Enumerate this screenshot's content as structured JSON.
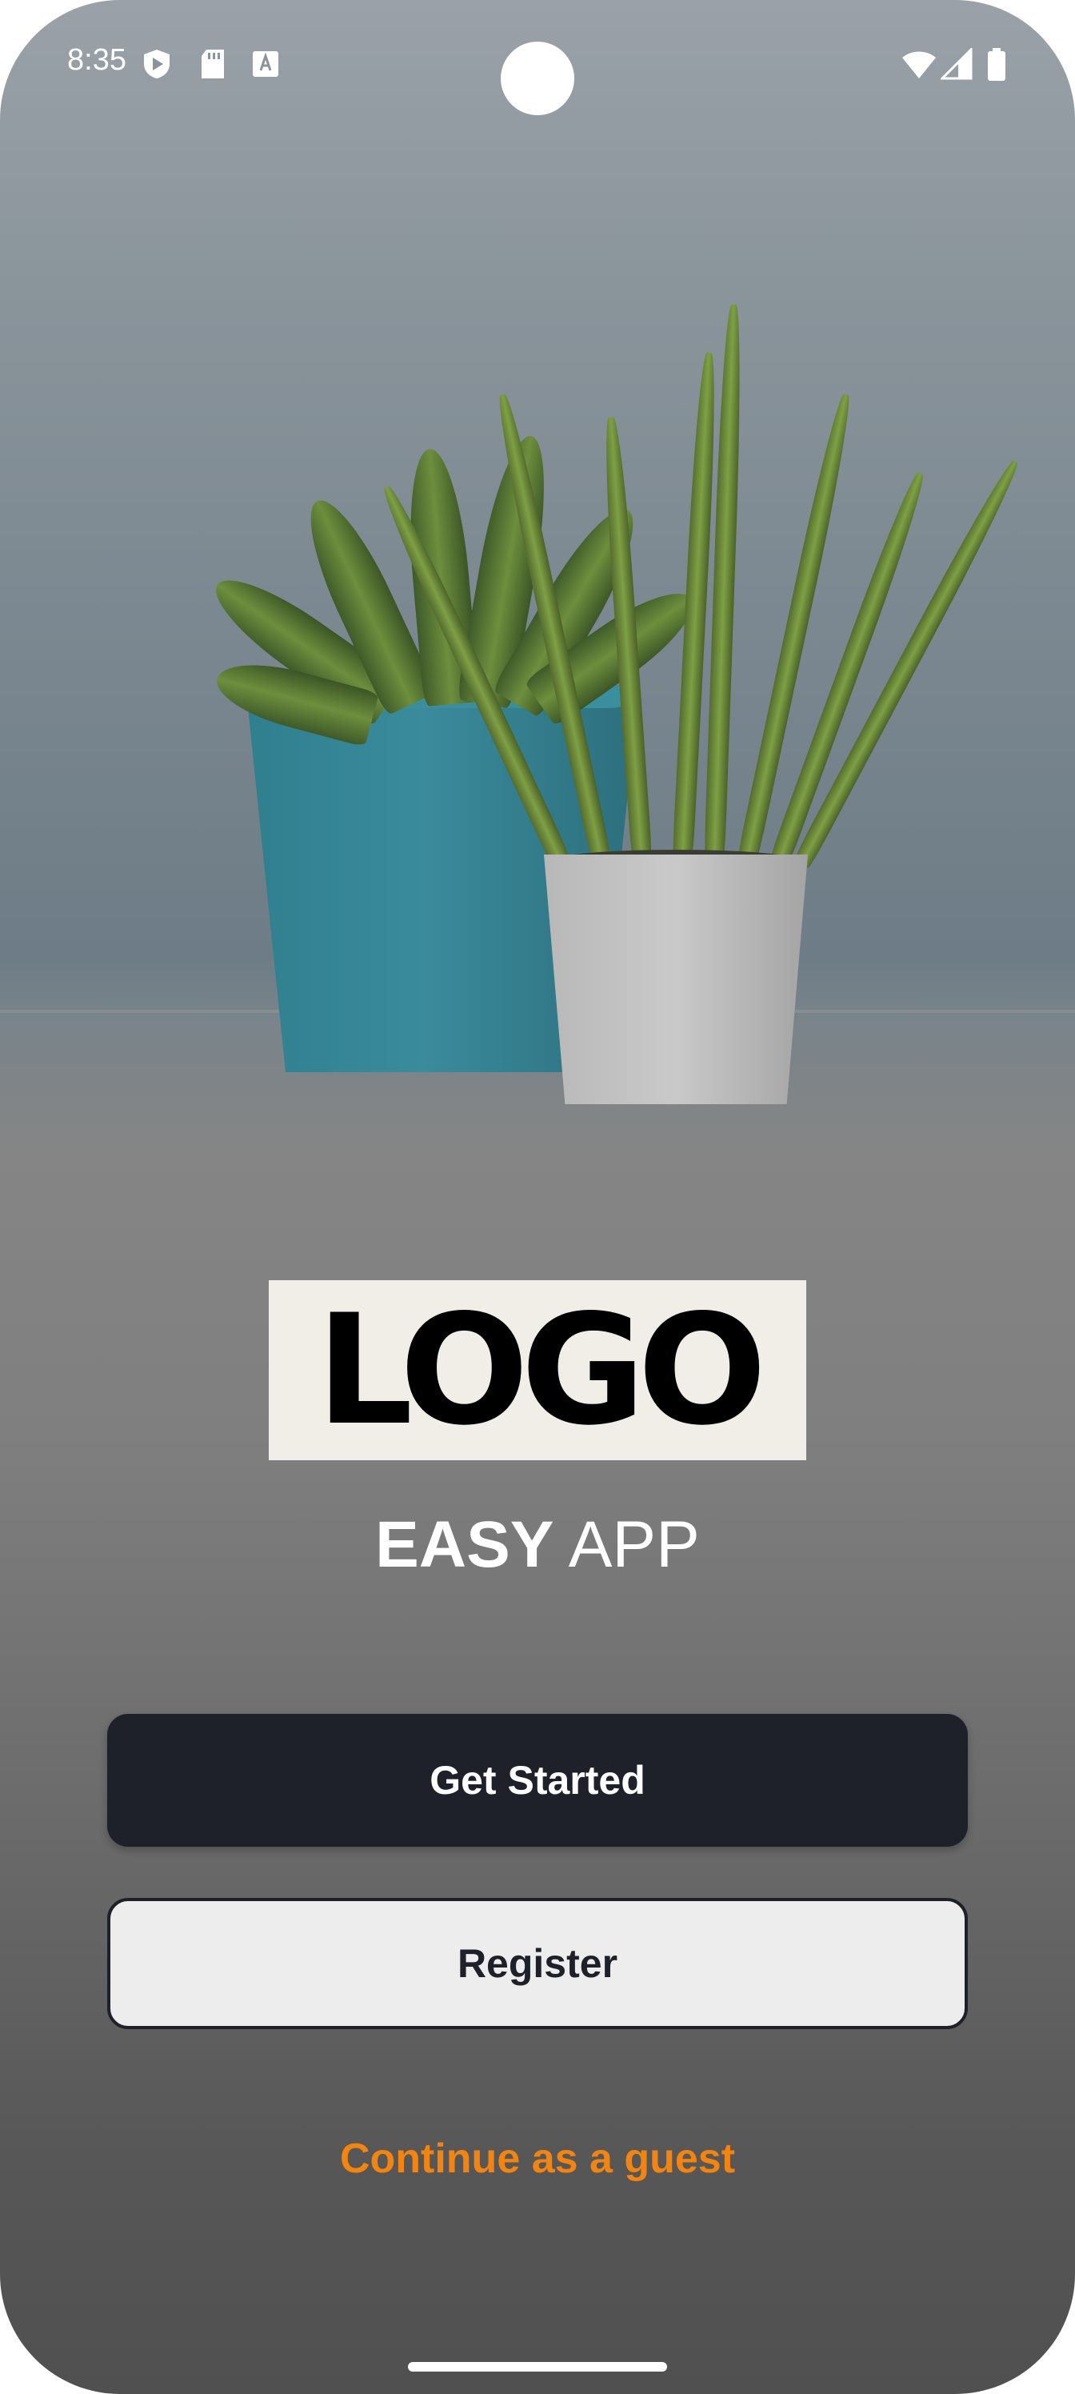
{
  "status_bar": {
    "time": "8:35",
    "left_icons": [
      "shield-play-icon",
      "sd-card-icon",
      "font-icon"
    ],
    "right_icons": [
      "wifi-icon",
      "signal-icon",
      "battery-icon"
    ]
  },
  "logo": {
    "text": "LOGO"
  },
  "app_title": {
    "bold": "EASY",
    "regular": "APP"
  },
  "buttons": {
    "get_started": "Get Started",
    "register": "Register"
  },
  "guest_link": "Continue as a guest",
  "colors": {
    "primary_button": "#1e2129",
    "secondary_button": "#ededed",
    "accent": "#f2840f",
    "logo_background": "#f1eee7"
  }
}
